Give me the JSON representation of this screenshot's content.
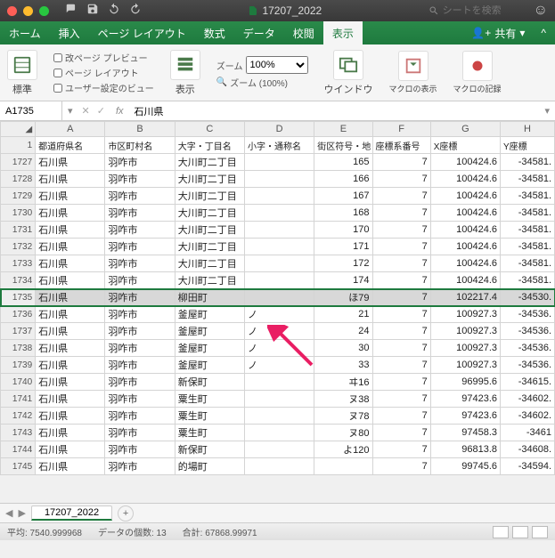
{
  "title": {
    "filename": "17207_2022",
    "search_placeholder": "シートを検索"
  },
  "tabs": {
    "home": "ホーム",
    "insert": "挿入",
    "layout": "ページ レイアウト",
    "formula": "数式",
    "data": "データ",
    "review": "校閲",
    "view": "表示",
    "share": "共有"
  },
  "ribbon": {
    "normal": "標準",
    "pb_preview": "改ページ プレビュー",
    "page_layout": "ページ レイアウト",
    "user_view": "ユーザー設定のビュー",
    "show": "表示",
    "zoom_label": "ズーム",
    "zoom_val": "100%",
    "zoom_full": "ズーム (100%)",
    "window": "ウインドウ",
    "macro_show": "マクロの表示",
    "macro_rec": "マクロの記録"
  },
  "formula_bar": {
    "cell": "A1735",
    "value": "石川県"
  },
  "columns": {
    "row": "1",
    "A": "A",
    "B": "B",
    "C": "C",
    "D": "D",
    "E": "E",
    "F": "F",
    "G": "G",
    "H": "H"
  },
  "headers": {
    "A": "都道府県名",
    "B": "市区町村名",
    "C": "大字・丁目名",
    "D": "小字・通称名",
    "E": "街区符号・地",
    "F": "座標系番号",
    "G": "X座標",
    "H": "Y座標"
  },
  "rows": [
    {
      "n": "1727",
      "A": "石川県",
      "B": "羽咋市",
      "C": "大川町二丁目",
      "D": "",
      "E": "165",
      "F": "7",
      "G": "100424.6",
      "H": "-34581."
    },
    {
      "n": "1728",
      "A": "石川県",
      "B": "羽咋市",
      "C": "大川町二丁目",
      "D": "",
      "E": "166",
      "F": "7",
      "G": "100424.6",
      "H": "-34581."
    },
    {
      "n": "1729",
      "A": "石川県",
      "B": "羽咋市",
      "C": "大川町二丁目",
      "D": "",
      "E": "167",
      "F": "7",
      "G": "100424.6",
      "H": "-34581."
    },
    {
      "n": "1730",
      "A": "石川県",
      "B": "羽咋市",
      "C": "大川町二丁目",
      "D": "",
      "E": "168",
      "F": "7",
      "G": "100424.6",
      "H": "-34581."
    },
    {
      "n": "1731",
      "A": "石川県",
      "B": "羽咋市",
      "C": "大川町二丁目",
      "D": "",
      "E": "170",
      "F": "7",
      "G": "100424.6",
      "H": "-34581."
    },
    {
      "n": "1732",
      "A": "石川県",
      "B": "羽咋市",
      "C": "大川町二丁目",
      "D": "",
      "E": "171",
      "F": "7",
      "G": "100424.6",
      "H": "-34581."
    },
    {
      "n": "1733",
      "A": "石川県",
      "B": "羽咋市",
      "C": "大川町二丁目",
      "D": "",
      "E": "172",
      "F": "7",
      "G": "100424.6",
      "H": "-34581."
    },
    {
      "n": "1734",
      "A": "石川県",
      "B": "羽咋市",
      "C": "大川町二丁目",
      "D": "",
      "E": "174",
      "F": "7",
      "G": "100424.6",
      "H": "-34581."
    },
    {
      "n": "1735",
      "A": "石川県",
      "B": "羽咋市",
      "C": "柳田町",
      "D": "",
      "E": "ほ79",
      "F": "7",
      "G": "102217.4",
      "H": "-34530.",
      "sel": true
    },
    {
      "n": "1736",
      "A": "石川県",
      "B": "羽咋市",
      "C": "釜屋町",
      "D": "ノ",
      "E": "21",
      "F": "7",
      "G": "100927.3",
      "H": "-34536."
    },
    {
      "n": "1737",
      "A": "石川県",
      "B": "羽咋市",
      "C": "釜屋町",
      "D": "ノ",
      "E": "24",
      "F": "7",
      "G": "100927.3",
      "H": "-34536."
    },
    {
      "n": "1738",
      "A": "石川県",
      "B": "羽咋市",
      "C": "釜屋町",
      "D": "ノ",
      "E": "30",
      "F": "7",
      "G": "100927.3",
      "H": "-34536."
    },
    {
      "n": "1739",
      "A": "石川県",
      "B": "羽咋市",
      "C": "釜屋町",
      "D": "ノ",
      "E": "33",
      "F": "7",
      "G": "100927.3",
      "H": "-34536."
    },
    {
      "n": "1740",
      "A": "石川県",
      "B": "羽咋市",
      "C": "新保町",
      "D": "",
      "E": "ヰ16",
      "F": "7",
      "G": "96995.6",
      "H": "-34615."
    },
    {
      "n": "1741",
      "A": "石川県",
      "B": "羽咋市",
      "C": "粟生町",
      "D": "",
      "E": "ヌ38",
      "F": "7",
      "G": "97423.6",
      "H": "-34602."
    },
    {
      "n": "1742",
      "A": "石川県",
      "B": "羽咋市",
      "C": "粟生町",
      "D": "",
      "E": "ヌ78",
      "F": "7",
      "G": "97423.6",
      "H": "-34602."
    },
    {
      "n": "1743",
      "A": "石川県",
      "B": "羽咋市",
      "C": "粟生町",
      "D": "",
      "E": "ヌ80",
      "F": "7",
      "G": "97458.3",
      "H": "-3461"
    },
    {
      "n": "1744",
      "A": "石川県",
      "B": "羽咋市",
      "C": "新保町",
      "D": "",
      "E": "よ120",
      "F": "7",
      "G": "96813.8",
      "H": "-34608."
    },
    {
      "n": "1745",
      "A": "石川県",
      "B": "羽咋市",
      "C": "的場町",
      "D": "",
      "E": "",
      "F": "7",
      "G": "99745.6",
      "H": "-34594."
    }
  ],
  "sheet_tab": "17207_2022",
  "status": {
    "avg": "平均: 7540.999968",
    "count": "データの個数: 13",
    "sum": "合計: 67868.99971"
  }
}
